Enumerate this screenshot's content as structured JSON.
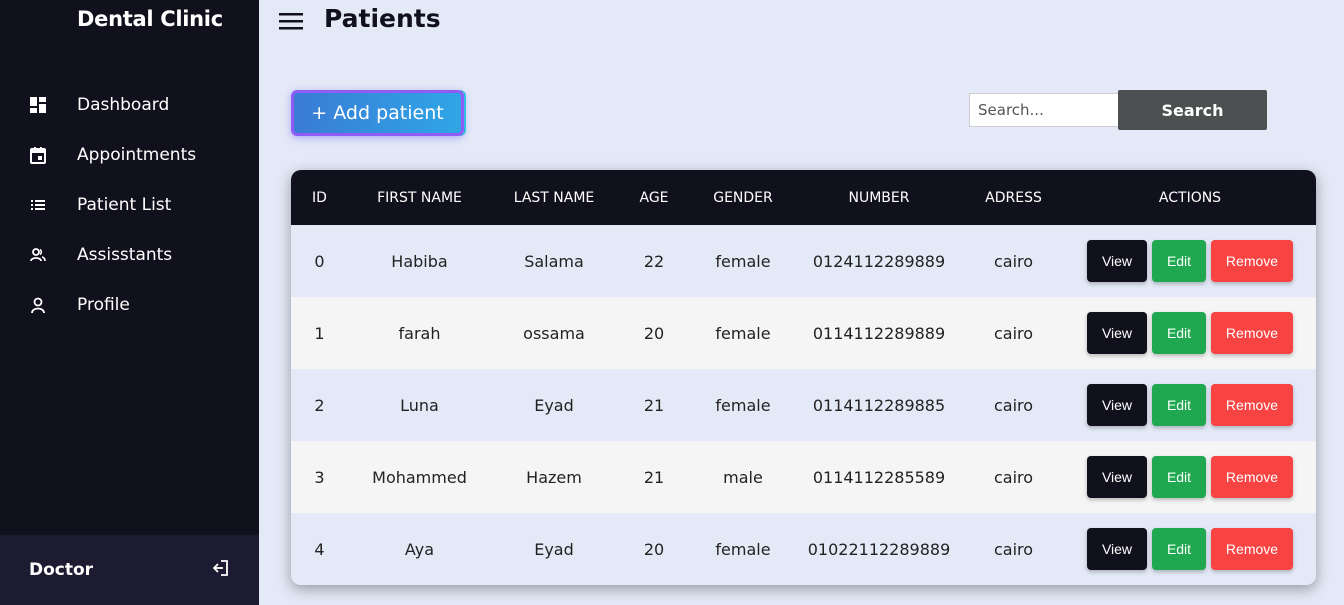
{
  "sidebar": {
    "brand": "Dental Clinic",
    "items": [
      {
        "label": "Dashboard",
        "icon": "dashboard-icon"
      },
      {
        "label": "Appointments",
        "icon": "calendar-icon"
      },
      {
        "label": "Patient List",
        "icon": "list-icon"
      },
      {
        "label": "Assisstants",
        "icon": "users-icon"
      },
      {
        "label": "Profile",
        "icon": "user-icon"
      }
    ],
    "profile": {
      "name": "Doctor",
      "icon": "logout-icon"
    }
  },
  "header": {
    "title": "Patients",
    "menu_icon": "hamburger-menu-icon"
  },
  "toolbar": {
    "add_label": "+ Add patient",
    "search_placeholder": "Search...",
    "search_value": "",
    "search_button": "Search"
  },
  "table": {
    "columns": [
      "ID",
      "FIRST NAME",
      "LAST NAME",
      "AGE",
      "GENDER",
      "NUMBER",
      "ADRESS",
      "ACTIONS"
    ],
    "action_labels": {
      "view": "View",
      "edit": "Edit",
      "remove": "Remove"
    },
    "rows": [
      {
        "id": "0",
        "first": "Habiba",
        "last": "Salama",
        "age": "22",
        "gender": "female",
        "number": "0124112289889",
        "address": "cairo"
      },
      {
        "id": "1",
        "first": "farah",
        "last": "ossama",
        "age": "20",
        "gender": "female",
        "number": "0114112289889",
        "address": "cairo"
      },
      {
        "id": "2",
        "first": "Luna",
        "last": "Eyad",
        "age": "21",
        "gender": "female",
        "number": "0114112289885",
        "address": "cairo"
      },
      {
        "id": "3",
        "first": "Mohammed",
        "last": "Hazem",
        "age": "21",
        "gender": "male",
        "number": "0114112285589",
        "address": "cairo"
      },
      {
        "id": "4",
        "first": "Aya",
        "last": "Eyad",
        "age": "20",
        "gender": "female",
        "number": "01022112289889",
        "address": "cairo"
      }
    ]
  },
  "colors": {
    "sidebar_bg": "#11101d",
    "page_bg": "#e4e9f7",
    "view": "#11101d",
    "edit": "#1fa84f",
    "remove": "#f84343",
    "search_button": "#4d5051"
  }
}
